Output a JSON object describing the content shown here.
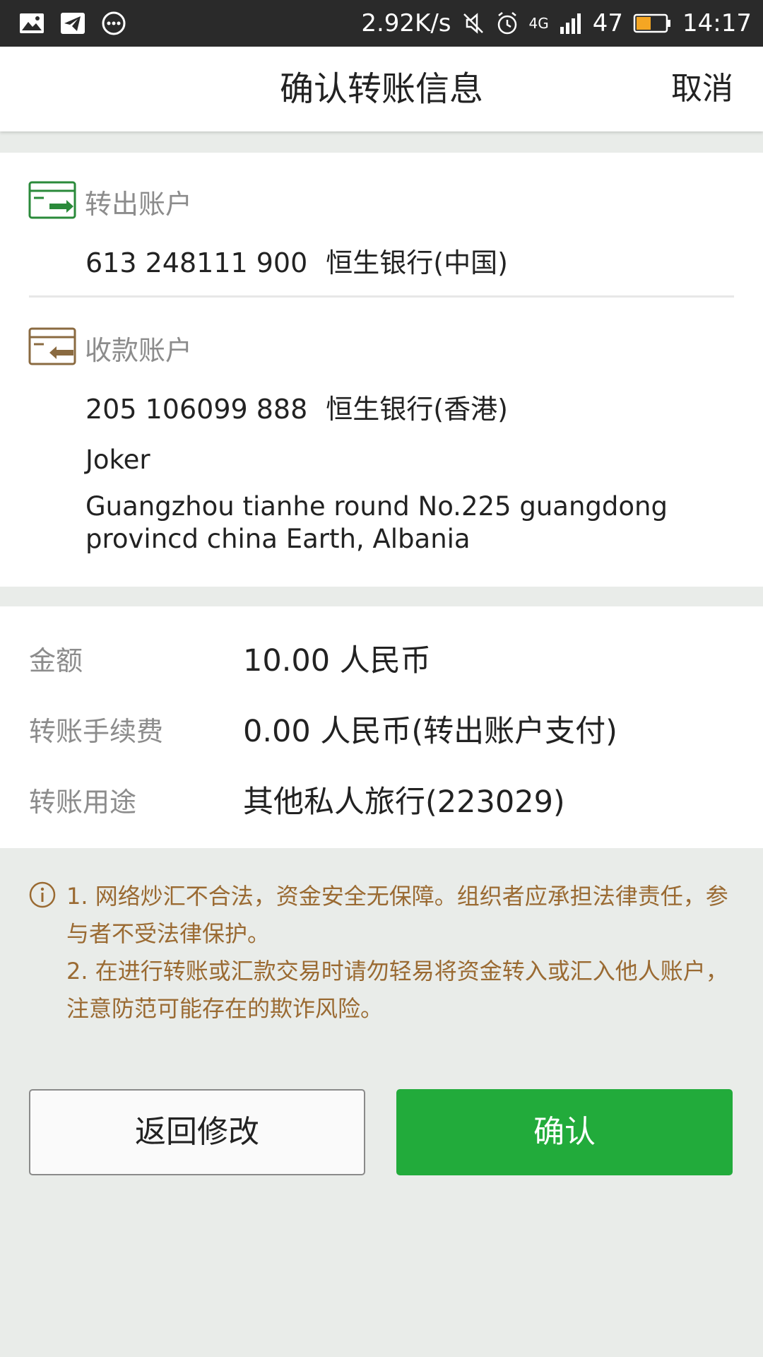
{
  "status_bar": {
    "net_speed": "2.92K/s",
    "network": "4G",
    "battery": "47",
    "time": "14:17"
  },
  "header": {
    "title": "确认转账信息",
    "cancel_label": "取消"
  },
  "from_account": {
    "label": "转出账户",
    "number": "613 248111 900",
    "bank": "恒生银行(中国)"
  },
  "to_account": {
    "label": "收款账户",
    "number": "205 106099 888",
    "bank": "恒生银行(香港)",
    "name": "Joker",
    "address_line1": "Guangzhou tianhe round No.225 guangdong",
    "address_line2": "provincd china Earth, Albania"
  },
  "details": {
    "amount_label": "金额",
    "amount_value": "10.00 人民币",
    "fee_label": "转账手续费",
    "fee_value": "0.00 人民币(转出账户支付)",
    "purpose_label": "转账用途",
    "purpose_value": "其他私人旅行(223029)"
  },
  "warning": {
    "line1": "1. 网络炒汇不合法，资金安全无保障。组织者应承担法律责任，参与者不受法律保护。",
    "line2": "2. 在进行转账或汇款交易时请勿轻易将资金转入或汇入他人账户，注意防范可能存在的欺诈风险。"
  },
  "buttons": {
    "back_label": "返回修改",
    "confirm_label": "确认"
  },
  "colors": {
    "accent_green": "#22ab3b",
    "warning_brown": "#9a6a32",
    "icon_green": "#2a8a3a",
    "icon_brown": "#8a6a40"
  }
}
